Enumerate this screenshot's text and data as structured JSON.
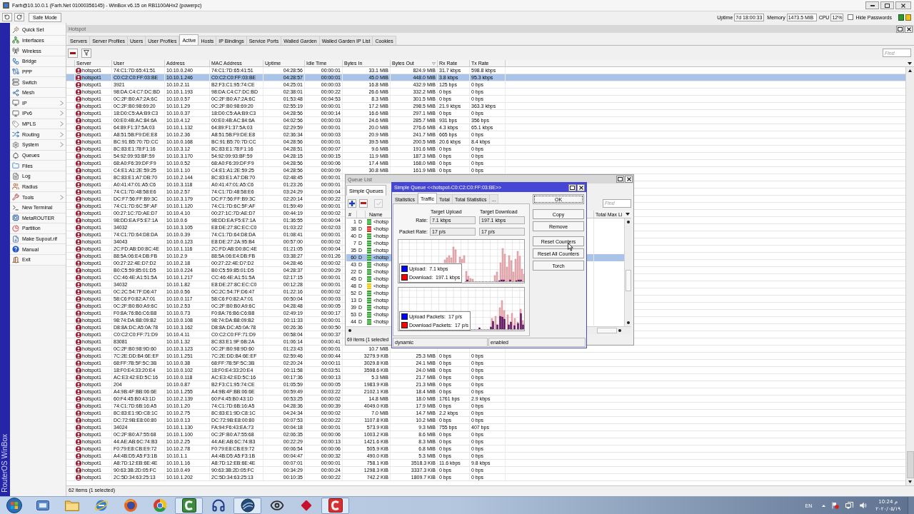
{
  "window": {
    "title": "Farh@10.10.0.1 (Farh.Net 01000356145) - WinBox v6.15 on RB1100AHx2 (powerpc)"
  },
  "toolbar": {
    "safe_mode": "Safe Mode",
    "uptime_label": "Uptime",
    "uptime": "7d 18:00:33",
    "memory_label": "Memory",
    "memory": "1473.5 MiB",
    "cpu_label": "CPU",
    "cpu": "12%",
    "hide_passwords": {
      "label": "Hide Passwords",
      "checked": false
    }
  },
  "banner": "RouterOS WinBox",
  "sidebar": {
    "items": [
      {
        "label": "Quick Set",
        "submenu": false
      },
      {
        "label": "Interfaces",
        "submenu": false
      },
      {
        "label": "Wireless",
        "submenu": false
      },
      {
        "label": "Bridge",
        "submenu": false
      },
      {
        "label": "PPP",
        "submenu": false
      },
      {
        "label": "Switch",
        "submenu": false
      },
      {
        "label": "Mesh",
        "submenu": false
      },
      {
        "label": "IP",
        "submenu": true
      },
      {
        "label": "IPv6",
        "submenu": true
      },
      {
        "label": "MPLS",
        "submenu": true
      },
      {
        "label": "Routing",
        "submenu": true
      },
      {
        "label": "System",
        "submenu": true
      },
      {
        "label": "Queues",
        "submenu": false
      },
      {
        "label": "Files",
        "submenu": false
      },
      {
        "label": "Log",
        "submenu": false
      },
      {
        "label": "Radius",
        "submenu": false
      },
      {
        "label": "Tools",
        "submenu": true
      },
      {
        "label": "New Terminal",
        "submenu": false
      },
      {
        "label": "MetaROUTER",
        "submenu": false
      },
      {
        "label": "Partition",
        "submenu": false
      },
      {
        "label": "Make Supout.rif",
        "submenu": false
      },
      {
        "label": "Manual",
        "submenu": false
      },
      {
        "label": "Exit",
        "submenu": false
      }
    ]
  },
  "hotspot": {
    "title": "Hotspot",
    "tabs": [
      {
        "label": "Servers",
        "selected": false
      },
      {
        "label": "Server Profiles",
        "selected": false
      },
      {
        "label": "Users",
        "selected": false
      },
      {
        "label": "User Profiles",
        "selected": false
      },
      {
        "label": "Active",
        "selected": true
      },
      {
        "label": "Hosts",
        "selected": false
      },
      {
        "label": "IP Bindings",
        "selected": false
      },
      {
        "label": "Service Ports",
        "selected": false
      },
      {
        "label": "Walled Garden",
        "selected": false
      },
      {
        "label": "Walled Garden IP List",
        "selected": false
      },
      {
        "label": "Cookies",
        "selected": false
      }
    ],
    "find_placeholder": "Find",
    "columns": [
      {
        "label": "Server",
        "sorted": false
      },
      {
        "label": "User",
        "sorted": false
      },
      {
        "label": "Address",
        "sorted": false
      },
      {
        "label": "MAC Address",
        "sorted": false
      },
      {
        "label": "Uptime",
        "sorted": false
      },
      {
        "label": "Idle Time",
        "sorted": false
      },
      {
        "label": "Bytes In",
        "sorted": false
      },
      {
        "label": "Bytes Out",
        "sorted": true
      },
      {
        "label": "Rx Rate",
        "sorted": false
      },
      {
        "label": "Tx Rate",
        "sorted": false
      }
    ],
    "rows": [
      {
        "selected": false,
        "cells": [
          "hotspot1",
          "74:C1:7D:65:41:51",
          "10.10.0.240",
          "74:C1:7D:65:41:51",
          "04:28:56",
          "00:00:01",
          "33.1 MiB",
          "824.9 MiB",
          "31.7 kbps",
          "598.8 kbps"
        ]
      },
      {
        "selected": true,
        "cells": [
          "hotspot1",
          "C0:C2:C0:FF:03:BE",
          "10.10.1.246",
          "C0:C2:C0:FF:03:BE",
          "04:28:57",
          "00:00:01",
          "45.0 MiB",
          "448.0 MiB",
          "3.8 kbps",
          "95.3 kbps"
        ]
      },
      {
        "selected": false,
        "cells": [
          "hotspot1",
          "3921",
          "10.10.2.11",
          "B2:F3:C1:95:74:CE",
          "04:25:01",
          "00:00:03",
          "16.8 MiB",
          "432.9 MiB",
          "125 bps",
          "0 bps"
        ]
      },
      {
        "selected": false,
        "cells": [
          "hotspot1",
          "98:DA:C4:C7:DC:BD",
          "10.10.1.193",
          "98:DA:C4:C7:DC:BD",
          "02:38:01",
          "00:00:22",
          "26.6 MiB",
          "332.2 MiB",
          "0 bps",
          "0 bps"
        ]
      },
      {
        "selected": false,
        "cells": [
          "hotspot1",
          "0C:2F:B0:A7:2A:6C",
          "10.10.0.57",
          "0C:2F:B0:A7:2A:6C",
          "01:53:48",
          "00:04:53",
          "8.3 MiB",
          "301.5 MiB",
          "0 bps",
          "0 bps"
        ]
      },
      {
        "selected": false,
        "cells": [
          "hotspot1",
          "0C:2F:B0:98:69:20",
          "10.10.1.29",
          "0C:2F:B0:98:69:20",
          "02:55:19",
          "00:00:01",
          "17.2 MiB",
          "298.5 MiB",
          "21.9 kbps",
          "363.3 kbps"
        ]
      },
      {
        "selected": false,
        "cells": [
          "hotspot1",
          "18:D0:C5:AA:B9:C3",
          "10.10.0.37",
          "18:D0:C5:AA:B9:C3",
          "04:28:56",
          "00:00:14",
          "16.6 MiB",
          "297.1 MiB",
          "0 bps",
          "0 bps"
        ]
      },
      {
        "selected": false,
        "cells": [
          "hotspot1",
          "00:E0:4B:AC:84:6A",
          "10.10.4.12",
          "00:E0:4B:AC:84:6A",
          "04:02:56",
          "00:00:03",
          "24.6 MiB",
          "285.7 MiB",
          "931 bps",
          "356 bps"
        ]
      },
      {
        "selected": false,
        "cells": [
          "hotspot1",
          "64:89:F1:37:5A:03",
          "10.10.1.132",
          "64:89:F1:37:5A:03",
          "02:29:59",
          "00:00:01",
          "20.0 MiB",
          "276.6 MiB",
          "4.3 kbps",
          "65.1 kbps"
        ]
      },
      {
        "selected": false,
        "cells": [
          "hotspot1",
          "A8:51:5B:F9:DE:E8",
          "10.10.2.36",
          "A8:51:5B:F9:DE:E8",
          "02:36:34",
          "00:00:03",
          "20.9 MiB",
          "241.7 MiB",
          "665 bps",
          "0 bps"
        ]
      },
      {
        "selected": false,
        "cells": [
          "hotspot1",
          "BC:91:B5:70:7D:CC",
          "10.10.0.168",
          "BC:91:B5:70:7D:CC",
          "04:28:56",
          "00:00:01",
          "39.5 MiB",
          "200.5 MiB",
          "20.6 kbps",
          "8.4 kbps"
        ]
      },
      {
        "selected": false,
        "cells": [
          "hotspot1",
          "8C:83:E1:78:F1:16",
          "10.10.3.12",
          "8C:83:E1:78:F1:16",
          "04:28:51",
          "00:00:07",
          "9.6 MiB",
          "191.6 MiB",
          "0 bps",
          "0 bps"
        ]
      },
      {
        "selected": false,
        "cells": [
          "hotspot1",
          "54:92:09:93:BF:59",
          "10.10.3.170",
          "54:92:09:93:BF:59",
          "04:28:15",
          "00:00:15",
          "11.9 MiB",
          "187.3 MiB",
          "0 bps",
          "0 bps"
        ]
      },
      {
        "selected": false,
        "cells": [
          "hotspot1",
          "68:A0:F6:39:DF:F9",
          "10.10.0.52",
          "68:A0:F6:39:DF:F9",
          "04:28:56",
          "00:00:06",
          "17.4 MiB",
          "168.0 MiB",
          "0 bps",
          "0 bps"
        ]
      },
      {
        "selected": false,
        "cells": [
          "hotspot1",
          "C4:E1:A1:2E:59:25",
          "10.10.1.10",
          "C4:E1:A1:2E:59:25",
          "04:28:56",
          "00:00:09",
          "30.8 MiB",
          "161.9 MiB",
          "0 bps",
          "0 bps"
        ]
      },
      {
        "selected": false,
        "cells": [
          "hotspot1",
          "8C:83:E1:A7:DB:70",
          "10.10.2.144",
          "8C:83:E1:A7:DB:70",
          "02:48:45",
          "00:00:01"
        ]
      },
      {
        "selected": false,
        "cells": [
          "hotspot1",
          "A0:41:47:01:A5:C6",
          "10.10.3.118",
          "A0:41:47:01:A5:C6",
          "01:23:26",
          "00:00:01"
        ]
      },
      {
        "selected": false,
        "cells": [
          "hotspot1",
          "74:C1:7D:48:58:E6",
          "10.10.2.57",
          "74:C1:7D:48:58:E6",
          "03:24:29",
          "00:00:04"
        ]
      },
      {
        "selected": false,
        "cells": [
          "hotspot1",
          "DC:F7:56:FF:B9:3C",
          "10.10.3.179",
          "DC:F7:56:FF:B9:3C",
          "02:20:14",
          "00:00:22"
        ]
      },
      {
        "selected": false,
        "cells": [
          "hotspot1",
          "74:C1:7D:6C:5F:AF",
          "10.10.1.120",
          "74:C1:7D:6C:5F:AF",
          "01:59:49",
          "00:00:01"
        ]
      },
      {
        "selected": false,
        "cells": [
          "hotspot1",
          "00:27:1C:7D:AE:D7",
          "10.10.4.10",
          "00:27:1C:7D:AE:D7",
          "00:44:19",
          "00:00:02"
        ]
      },
      {
        "selected": false,
        "cells": [
          "hotspot1",
          "98:DD:EA:F5:E7:1A",
          "10.10.0.6",
          "98:DD:EA:F5:E7:1A",
          "01:36:55",
          "00:00:04"
        ]
      },
      {
        "selected": false,
        "cells": [
          "hotspot1",
          "34032",
          "10.10.3.105",
          "E8:DE:27:8C:EC:C0",
          "01:03:22",
          "00:02:03"
        ]
      },
      {
        "selected": false,
        "cells": [
          "hotspot1",
          "74:C1:7D:64:D8:DA",
          "10.10.0.39",
          "74:C1:7D:64:D8:DA",
          "01:08:41",
          "00:00:01"
        ]
      },
      {
        "selected": false,
        "cells": [
          "hotspot1",
          "34043",
          "10.10.0.123",
          "E8:DE:27:2A:95:B4",
          "00:57:00",
          "00:00:02"
        ]
      },
      {
        "selected": false,
        "cells": [
          "hotspot1",
          "2C:FD:AB:D0:8C:4E",
          "10.10.1.116",
          "2C:FD:AB:D0:8C:4E",
          "01:21:05",
          "00:00:04"
        ]
      },
      {
        "selected": false,
        "cells": [
          "hotspot1",
          "88:5A:06:E4:DB:FB",
          "10.10.2.9",
          "88:5A:06:E4:DB:FB",
          "03:38:27",
          "00:01:26"
        ]
      },
      {
        "selected": false,
        "cells": [
          "hotspot1",
          "00:27:22:4E:D7:D2",
          "10.10.2.18",
          "00:27:22:4E:D7:D2",
          "04:28:46",
          "00:00:02"
        ]
      },
      {
        "selected": false,
        "cells": [
          "hotspot1",
          "B0:C5:59:85:01:D5",
          "10.10.0.224",
          "B0:C5:59:85:01:D5",
          "04:28:37",
          "00:00:29"
        ]
      },
      {
        "selected": false,
        "cells": [
          "hotspot1",
          "CC:46:4E:A1:51:5A",
          "10.10.1.217",
          "CC:46:4E:A1:51:5A",
          "02:17:15",
          "00:00:01"
        ]
      },
      {
        "selected": false,
        "cells": [
          "hotspot1",
          "34032",
          "10.10.1.82",
          "E8:DE:27:8C:EC:C0",
          "00:12:28",
          "00:00:01"
        ]
      },
      {
        "selected": false,
        "cells": [
          "hotspot1",
          "0C:2C:54:7F:D6:47",
          "10.10.0.56",
          "0C:2C:54:7F:D6:47",
          "01:22:16",
          "00:00:02"
        ]
      },
      {
        "selected": false,
        "cells": [
          "hotspot1",
          "58:C6:F0:82:A7:01",
          "10.10.0.117",
          "58:C6:F0:82:A7:01",
          "00:50:04",
          "00:00:03"
        ]
      },
      {
        "selected": false,
        "cells": [
          "hotspot1",
          "0C:2F:B0:B0:A9:6C",
          "10.10.2.53",
          "0C:2F:B0:B0:A9:6C",
          "04:28:48",
          "00:00:05"
        ]
      },
      {
        "selected": false,
        "cells": [
          "hotspot1",
          "F0:8A:76:B6:C6:B8",
          "10.10.0.73",
          "F0:8A:76:B6:C6:B8",
          "02:49:19",
          "00:00:17"
        ]
      },
      {
        "selected": false,
        "cells": [
          "hotspot1",
          "98:74:DA:B8:09:B2",
          "10.10.0.108",
          "98:74:DA:B8:09:B2",
          "00:11:33",
          "00:00:01"
        ]
      },
      {
        "selected": false,
        "cells": [
          "hotspot1",
          "D8:8A:DC:A5:0A:78",
          "10.10.3.162",
          "D8:8A:DC:A5:0A:78",
          "00:26:36",
          "00:00:50"
        ]
      },
      {
        "selected": false,
        "cells": [
          "hotspot1",
          "C0:C2:C0:FF:71:D9",
          "10.10.4.11",
          "C0:C2:C0:FF:71:D9",
          "00:58:04",
          "00:00:37"
        ]
      },
      {
        "selected": false,
        "cells": [
          "hotspot1",
          "83081",
          "10.10.1.32",
          "8C:83:E1:9F:6B:2A",
          "01:06:14",
          "00:00:41"
        ]
      },
      {
        "selected": false,
        "cells": [
          "hotspot1",
          "0C:2F:B0:98:9D:60",
          "10.10.3.123",
          "0C:2F:B0:98:9D:60",
          "01:23:43",
          "00:00:01",
          "10.7 MiB"
        ]
      },
      {
        "selected": false,
        "cells": [
          "hotspot1",
          "7C:2E:DD:B4:6E:EF",
          "10.10.1.251",
          "7C:2E:DD:B4:6E:EF",
          "02:59:46",
          "00:00:44",
          "3279.9 KiB",
          "25.3 MiB",
          "0 bps",
          "0 bps"
        ]
      },
      {
        "selected": false,
        "cells": [
          "hotspot1",
          "68:FF:7B:5F:5C:3B",
          "10.10.0.38",
          "68:FF:7B:5F:5C:3B",
          "02:20:24",
          "00:00:11",
          "3029.8 KiB",
          "24.1 MiB",
          "0 bps",
          "0 bps"
        ]
      },
      {
        "selected": false,
        "cells": [
          "hotspot1",
          "18:F0:E4:33:20:E4",
          "10.10.0.102",
          "18:F0:E4:33:20:E4",
          "00:11:58",
          "00:03:51",
          "3598.6 KiB",
          "24.0 MiB",
          "0 bps",
          "0 bps"
        ]
      },
      {
        "selected": false,
        "cells": [
          "hotspot1",
          "AC:E3:42:ED:5C:16",
          "10.10.0.118",
          "AC:E3:42:ED:5C:16",
          "00:17:36",
          "00:00:13",
          "5.3 MiB",
          "21.7 MiB",
          "0 bps",
          "0 bps"
        ]
      },
      {
        "selected": false,
        "cells": [
          "hotspot1",
          "204",
          "10.10.0.87",
          "B2:F3:C1:95:74:CE",
          "01:05:59",
          "00:00:05",
          "1983.9 KiB",
          "21.3 MiB",
          "0 bps",
          "0 bps"
        ]
      },
      {
        "selected": false,
        "cells": [
          "hotspot1",
          "A4:9B:4F:BB:06:6E",
          "10.10.1.255",
          "A4:9B:4F:BB:06:6E",
          "00:59:49",
          "00:03:22",
          "2102.1 KiB",
          "18.4 MiB",
          "0 bps",
          "0 bps"
        ]
      },
      {
        "selected": false,
        "cells": [
          "hotspot1",
          "60:F4:45:B0:43:1D",
          "10.10.2.139",
          "60:F4:45:B0:43:1D",
          "00:53:25",
          "00:00:02",
          "14.8 MiB",
          "18.0 MiB",
          "1761 bps",
          "2.9 kbps"
        ]
      },
      {
        "selected": false,
        "cells": [
          "hotspot1",
          "74:C1:7D:6B:16:A5",
          "10.10.1.20",
          "74:C1:7D:6B:16:A5",
          "04:28:36",
          "00:00:39",
          "4049.0 KiB",
          "17.9 MiB",
          "0 bps",
          "0 bps"
        ]
      },
      {
        "selected": false,
        "cells": [
          "hotspot1",
          "8C:83:E1:9D:C8:1C",
          "10.10.2.75",
          "8C:83:E1:9D:C8:1C",
          "04:24:34",
          "00:00:02",
          "7.0 MiB",
          "14.7 MiB",
          "2.2 kbps",
          "0 bps"
        ]
      },
      {
        "selected": false,
        "cells": [
          "hotspot1",
          "DC:72:9B:E8:00:80",
          "10.10.0.13",
          "DC:72:9B:E8:00:80",
          "00:07:53",
          "00:00:22",
          "1107.8 KiB",
          "10.2 MiB",
          "0 bps",
          "0 bps"
        ]
      },
      {
        "selected": false,
        "cells": [
          "hotspot1",
          "34024",
          "10.10.1.130",
          "FA:94:F6:43:EA:73",
          "00:04:18",
          "00:00:01",
          "573.9 KiB",
          "9.3 MiB",
          "755 bps",
          "407 bps"
        ]
      },
      {
        "selected": false,
        "cells": [
          "hotspot1",
          "0C:2F:B0:A7:55:68",
          "10.10.1.100",
          "0C:2F:B0:A7:55:68",
          "02:06:35",
          "00:00:06",
          "1003.2 KiB",
          "8.6 MiB",
          "0 bps",
          "0 bps"
        ]
      },
      {
        "selected": false,
        "cells": [
          "hotspot1",
          "44:AE:AB:6C:74:B3",
          "10.10.2.25",
          "44:AE:AB:6C:74:B3",
          "00:22:29",
          "00:00:13",
          "1421.6 KiB",
          "8.3 MiB",
          "0 bps",
          "0 bps"
        ]
      },
      {
        "selected": false,
        "cells": [
          "hotspot1",
          "F0:79:E8:CB:E9:72",
          "10.10.2.78",
          "F0:79:E8:CB:E9:72",
          "00:06:54",
          "00:00:06",
          "505.9 KiB",
          "6.8 MiB",
          "0 bps",
          "0 bps"
        ]
      },
      {
        "selected": false,
        "cells": [
          "hotspot1",
          "A4:4B:D5:A5:F3:1B",
          "10.10.1.1",
          "A4:4B:D5:A5:F3:1B",
          "00:04:47",
          "00:00:32",
          "490.0 KiB",
          "5.3 MiB",
          "0 bps",
          "0 bps"
        ]
      },
      {
        "selected": false,
        "cells": [
          "hotspot1",
          "A8:7D:12:EB:6E:4E",
          "10.10.1.16",
          "A8:7D:12:EB:6E:4E",
          "00:07:01",
          "00:00:01",
          "758.1 KiB",
          "3518.3 KiB",
          "11.6 kbps",
          "9.8 kbps"
        ]
      },
      {
        "selected": false,
        "cells": [
          "hotspot1",
          "90:63:3B:2D:05:FC",
          "10.10.0.49",
          "90:63:3B:2D:05:FC",
          "00:34:29",
          "00:00:24",
          "1298.3 KiB",
          "3337.3 KiB",
          "0 bps",
          "0 bps"
        ]
      },
      {
        "selected": false,
        "cells": [
          "hotspot1",
          "2C:5D:34:63:25:13",
          "10.10.1.202",
          "2C:5D:34:63:25:13",
          "00:10:35",
          "00:00:22",
          "742.2 KiB",
          "1809.7 KiB",
          "0 bps",
          "0 bps"
        ]
      }
    ],
    "status": "62 items (1 selected)"
  },
  "queue_list": {
    "title": "Queue List",
    "tabs": [
      {
        "label": "Simple Queues",
        "selected": true
      }
    ],
    "find_placeholder": "Find",
    "columns": [
      "#",
      "Name",
      "Total Max Li"
    ],
    "rows": [
      {
        "number": "1",
        "flag": "D",
        "name": "<hotsp",
        "color": "#2ea02e",
        "selected": false
      },
      {
        "number": "38",
        "flag": "D",
        "name": "<hotsp",
        "color": "#e02020",
        "selected": false
      },
      {
        "number": "40",
        "flag": "D",
        "name": "<hotsp",
        "color": "#2ea02e",
        "selected": false
      },
      {
        "number": "7",
        "flag": "D",
        "name": "<hotsp",
        "color": "#2ea02e",
        "selected": false
      },
      {
        "number": "35",
        "flag": "D",
        "name": "<hotsp",
        "color": "#2ea02e",
        "selected": false
      },
      {
        "number": "60",
        "flag": "D",
        "name": "<hotsp",
        "color": "#2ea02e",
        "selected": true
      },
      {
        "number": "43",
        "flag": "D",
        "name": "<hotsp",
        "color": "#2ea02e",
        "selected": false
      },
      {
        "number": "22",
        "flag": "D",
        "name": "<hotsp",
        "color": "#2ea02e",
        "selected": false
      },
      {
        "number": "45",
        "flag": "D",
        "name": "<hotsp",
        "color": "#2ea02e",
        "selected": false
      },
      {
        "number": "48",
        "flag": "D",
        "name": "<hotsp",
        "color": "#e8c800",
        "selected": false
      },
      {
        "number": "52",
        "flag": "D",
        "name": "<hotsp",
        "color": "#2ea02e",
        "selected": false
      },
      {
        "number": "13",
        "flag": "D",
        "name": "<hotsp",
        "color": "#2ea02e",
        "selected": false
      },
      {
        "number": "39",
        "flag": "D",
        "name": "<hotsp",
        "color": "#2ea02e",
        "selected": false
      },
      {
        "number": "53",
        "flag": "D",
        "name": "<hotsp",
        "color": "#2ea02e",
        "selected": false
      },
      {
        "number": "44",
        "flag": "D",
        "name": "<hotsp",
        "color": "#2ea02e",
        "selected": false
      }
    ],
    "status": "69 items (1 selected"
  },
  "simple_queue": {
    "title": "Simple Queue <<hotspot-C0:C2:C0:FF:03:BE>>",
    "tabs": [
      {
        "label": "Statistics",
        "selected": false
      },
      {
        "label": "Traffic",
        "selected": true
      },
      {
        "label": "Total",
        "selected": false
      },
      {
        "label": "Total Statistics",
        "selected": false
      },
      {
        "label": "...",
        "selected": false
      }
    ],
    "column_labels": [
      "Target Upload",
      "Target Download"
    ],
    "fields": [
      {
        "label": "Rate:",
        "values": [
          "7.1 kbps",
          "197.1 kbps"
        ]
      },
      {
        "label": "Packet Rate:",
        "values": [
          "17 p/s",
          "17 p/s"
        ]
      }
    ],
    "graphs": [
      {
        "legend": [
          {
            "label": "Upload:",
            "value": "7.1 kbps",
            "color": "#0000ff"
          },
          {
            "label": "Download:",
            "value": "197.1 kbps",
            "color": "#ff0000"
          }
        ]
      },
      {
        "legend": [
          {
            "label": "Upload Packets:",
            "value": "17 p/s",
            "color": "#0000ff"
          },
          {
            "label": "Download Packets:",
            "value": "17 p/s",
            "color": "#ff0000"
          }
        ]
      }
    ],
    "button_groups": [
      [
        {
          "label": "OK",
          "focused": true
        }
      ],
      [
        {
          "label": "Copy",
          "focused": false
        },
        {
          "label": "Remove",
          "focused": false
        }
      ],
      [
        {
          "label": "Reset Counters",
          "focused": false
        },
        {
          "label": "Reset All Counters",
          "focused": false
        },
        {
          "label": "Torch",
          "focused": false
        }
      ]
    ],
    "status": [
      "dynamic",
      "enabled"
    ]
  },
  "taskbar": {
    "apps": [
      {
        "active": false
      },
      {
        "active": false
      },
      {
        "active": false
      },
      {
        "active": false
      },
      {
        "active": false
      },
      {
        "active": true
      },
      {
        "active": false
      },
      {
        "active": true
      },
      {
        "active": false
      },
      {
        "active": false
      },
      {
        "active": true
      }
    ],
    "language": "EN",
    "time": "10:24 م",
    "date": "۲۰۲۰/۰۵/۱۹"
  }
}
